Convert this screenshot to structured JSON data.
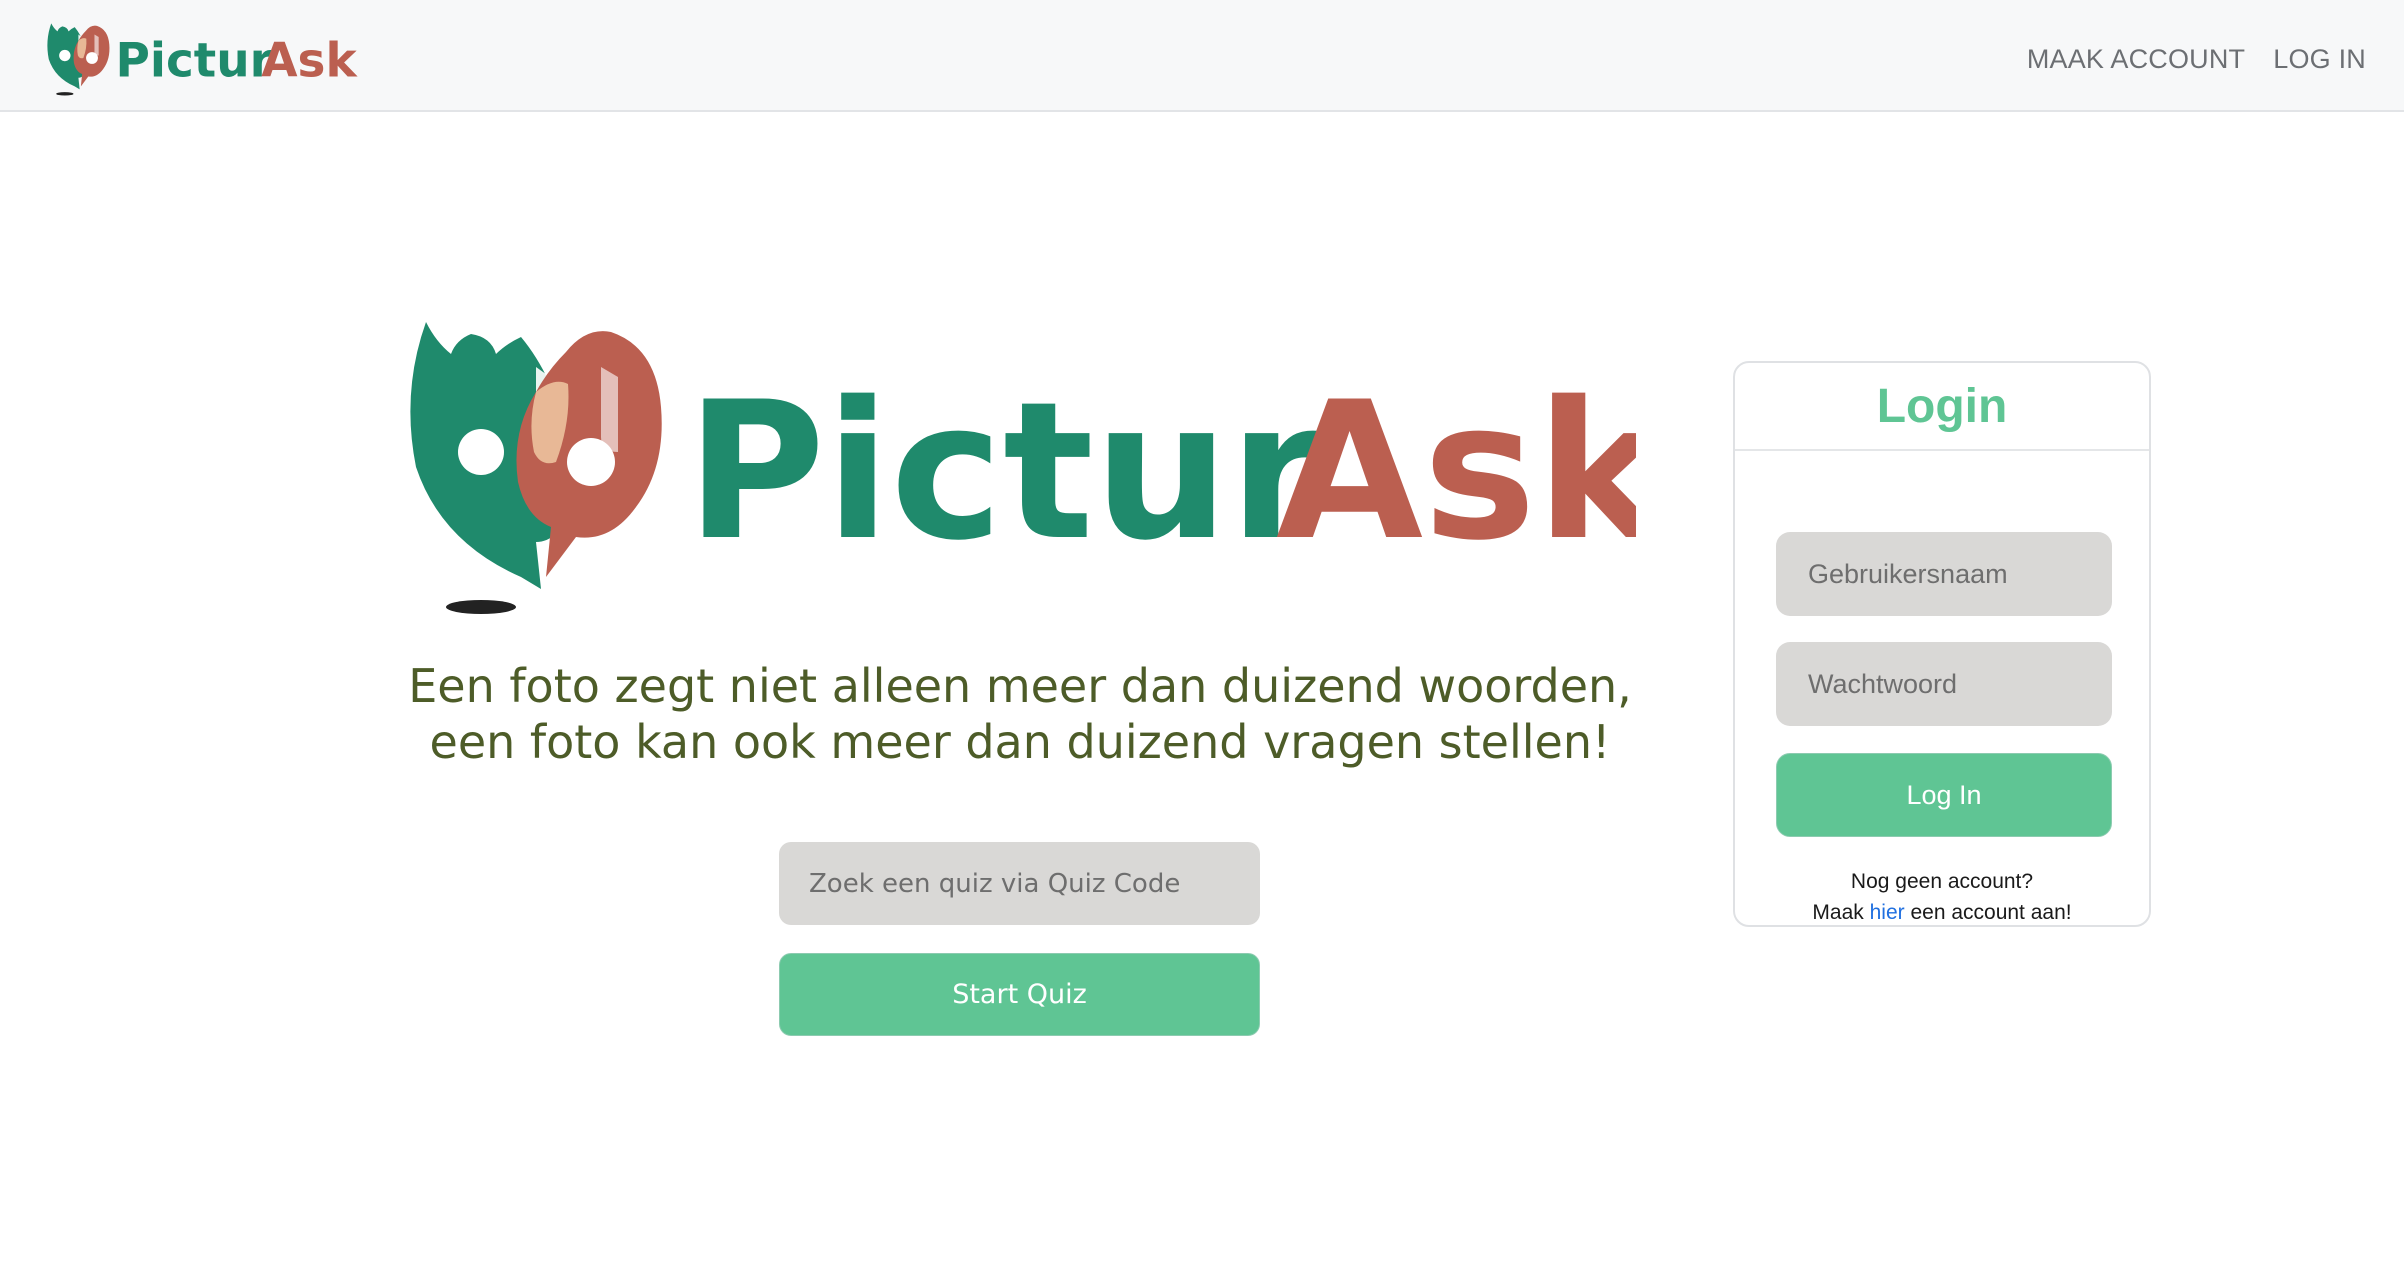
{
  "brand": {
    "name_part1": "Pictur",
    "name_part2": "Ask",
    "color_green": "#1f8a6c",
    "color_red": "#bb5f50",
    "color_peach": "#e8b896",
    "logo_icon": "speech-bubbles-question-marks-icon"
  },
  "nav": {
    "links": [
      "MAAK ACCOUNT",
      "LOG IN"
    ]
  },
  "hero": {
    "slogan_line1": "Een foto zegt niet alleen meer dan duizend woorden,",
    "slogan_line2": "een foto kan ook meer dan duizend vragen stellen!"
  },
  "quiz": {
    "search_placeholder": "Zoek een quiz via Quiz Code",
    "start_label": "Start Quiz"
  },
  "login": {
    "title": "Login",
    "username_placeholder": "Gebruikersnaam",
    "password_placeholder": "Wachtwoord",
    "submit_label": "Log In",
    "no_account_text": "Nog geen account?",
    "register_prefix": "Maak ",
    "register_link": "hier",
    "register_suffix": " een account aan!"
  },
  "colors": {
    "accent": "#5fc594",
    "input_bg": "#d9d8d6",
    "slogan": "#4d5c28",
    "link": "#1f6fe0",
    "nav_bg": "#f7f8f9"
  }
}
